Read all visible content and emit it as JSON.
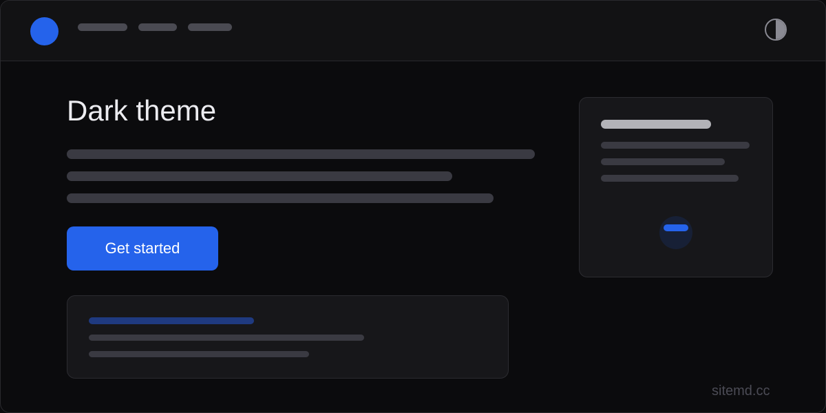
{
  "header": {
    "logo_color": "#2563eb",
    "nav_items": [
      "nav-placeholder",
      "nav-placeholder",
      "nav-placeholder"
    ],
    "theme_toggle_icon": "half-filled-circle-icon"
  },
  "hero": {
    "title": "Dark theme",
    "cta_label": "Get started"
  },
  "side_card": {
    "action_icon": "minus-icon"
  },
  "footer": {
    "watermark": "sitemd.cc"
  },
  "colors": {
    "background": "#0b0b0d",
    "surface": "#121214",
    "card": "#17171a",
    "accent": "#2563eb",
    "text": "#ececf0",
    "muted": "#4b4b55"
  }
}
